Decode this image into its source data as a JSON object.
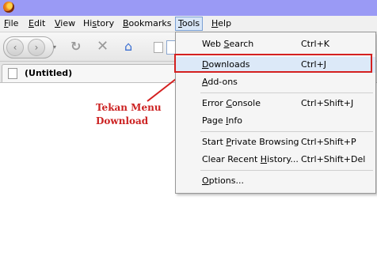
{
  "menubar": {
    "items": [
      {
        "label_pre": "",
        "label_ul": "F",
        "label_post": "ile"
      },
      {
        "label_pre": "",
        "label_ul": "E",
        "label_post": "dit"
      },
      {
        "label_pre": "",
        "label_ul": "V",
        "label_post": "iew"
      },
      {
        "label_pre": "Hi",
        "label_ul": "s",
        "label_post": "tory"
      },
      {
        "label_pre": "",
        "label_ul": "B",
        "label_post": "ookmarks"
      },
      {
        "label_pre": "",
        "label_ul": "T",
        "label_post": "ools"
      },
      {
        "label_pre": "",
        "label_ul": "H",
        "label_post": "elp"
      }
    ]
  },
  "navbar": {
    "back_icon": "‹",
    "forward_icon": "›",
    "dropdown_icon": "▾",
    "reload_icon": "↻",
    "stop_icon": "✕",
    "home_icon": "⌂"
  },
  "tab": {
    "title": "(Untitled)"
  },
  "tools_menu": {
    "items": [
      {
        "pre": "Web ",
        "ul": "S",
        "post": "earch",
        "shortcut": "Ctrl+K"
      },
      {
        "pre": "",
        "ul": "D",
        "post": "ownloads",
        "shortcut": "Ctrl+J"
      },
      {
        "pre": "",
        "ul": "A",
        "post": "dd-ons",
        "shortcut": ""
      },
      {
        "pre": "Error ",
        "ul": "C",
        "post": "onsole",
        "shortcut": "Ctrl+Shift+J"
      },
      {
        "pre": "Page ",
        "ul": "I",
        "post": "nfo",
        "shortcut": ""
      },
      {
        "pre": "Start ",
        "ul": "P",
        "post": "rivate Browsing",
        "shortcut": "Ctrl+Shift+P"
      },
      {
        "pre": "Clear Recent ",
        "ul": "H",
        "post": "istory...",
        "shortcut": "Ctrl+Shift+Del"
      },
      {
        "pre": "",
        "ul": "O",
        "post": "ptions...",
        "shortcut": ""
      }
    ]
  },
  "annotation": {
    "line1": "Tekan Menu",
    "line2": "Download",
    "color": "#cc2222"
  },
  "colors": {
    "titlebar": "#9a9af5",
    "highlight_border": "#d42020"
  }
}
